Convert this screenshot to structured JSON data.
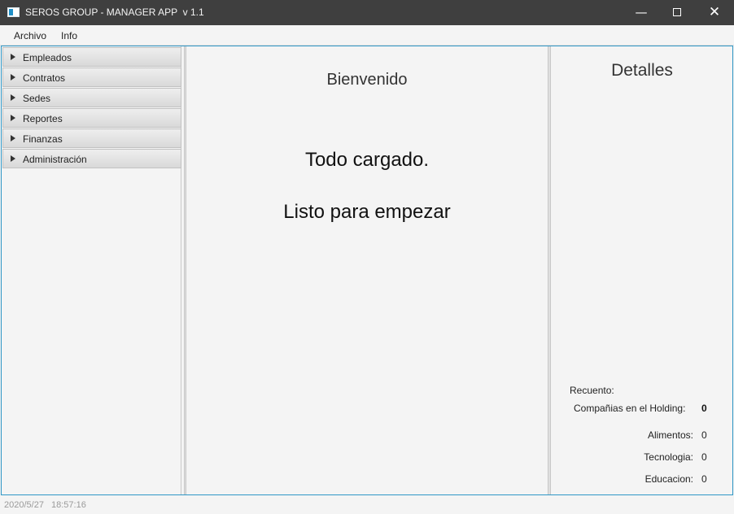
{
  "window": {
    "title": "SEROS GROUP - MANAGER APP  v 1.1",
    "icon": "app-window-icon",
    "controls": {
      "minimize": "—",
      "close": "✕"
    }
  },
  "menubar": {
    "items": [
      {
        "label": "Archivo"
      },
      {
        "label": "Info"
      }
    ]
  },
  "sidebar": {
    "items": [
      {
        "label": "Empleados",
        "icon": "triangle-right-icon"
      },
      {
        "label": "Contratos",
        "icon": "triangle-right-icon"
      },
      {
        "label": "Sedes",
        "icon": "triangle-right-icon"
      },
      {
        "label": "Reportes",
        "icon": "triangle-right-icon"
      },
      {
        "label": "Finanzas",
        "icon": "triangle-right-icon"
      },
      {
        "label": "Administración",
        "icon": "triangle-right-icon"
      }
    ]
  },
  "center": {
    "welcome": "Bienvenido",
    "loaded": "Todo cargado.",
    "ready": "Listo para empezar"
  },
  "details": {
    "title": "Detalles",
    "count_label": "Recuento:",
    "holding_label": "Compañias en el Holding:",
    "holding_value": "0",
    "rows": [
      {
        "label": "Alimentos:",
        "value": "0"
      },
      {
        "label": "Tecnologia:",
        "value": "0"
      },
      {
        "label": "Educacion:",
        "value": "0"
      }
    ]
  },
  "status": {
    "date": "2020/5/27",
    "time": "18:57:16"
  },
  "colors": {
    "titlebar": "#3f3f3f",
    "accent_border": "#2f97c6",
    "status_text": "#9a9a9a"
  }
}
